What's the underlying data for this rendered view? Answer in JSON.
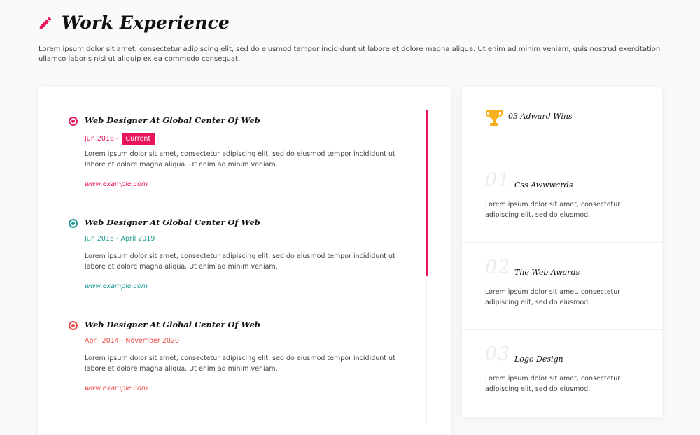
{
  "header": {
    "title": "Work Experience",
    "icon": "pencil-icon",
    "intro": "Lorem ipsum dolor sit amet, consectetur adipiscing elit, sed do eiusmod tempor incididunt ut labore et dolore magna aliqua. Ut enim ad minim veniam, quis nostrud exercitation ullamco laboris nisi ut aliquip ex ea commodo consequat."
  },
  "colors": {
    "accent": "#e9155b",
    "teal": "#1b9a8f",
    "coral": "#ec4c4c",
    "gold": "#f5b11b"
  },
  "experience": [
    {
      "title": "Web Designer At Global Center Of Web",
      "date": "Jun 2018 -",
      "badge": "Current",
      "description": "Lorem ipsum dolor sit amet, consectetur adipiscing elit, sed do eiusmod tempor incididunt ut labore et dolore magna aliqua. Ut enim ad minim veniam.",
      "link": "www.example.com"
    },
    {
      "title": "Web Designer At Global Center Of Web",
      "date": "Jun 2015 - April 2019",
      "description": "Lorem ipsum dolor sit amet, consectetur adipiscing elit, sed do eiusmod tempor incididunt ut labore et dolore magna aliqua. Ut enim ad minim veniam.",
      "link": "www.example.com"
    },
    {
      "title": "Web Designer At Global Center Of Web",
      "date": "April 2014 - November 2020",
      "description": "Lorem ipsum dolor sit amet, consectetur adipiscing elit, sed do eiusmod tempor incididunt ut labore et dolore magna aliqua. Ut enim ad minim veniam.",
      "link": "www.example.com"
    }
  ],
  "awards": {
    "count_label": "03 Adward Wins",
    "icon": "trophy-icon",
    "items": [
      {
        "number": "01",
        "title": "Css Awwwards",
        "description": "Lorem ipsum dolor sit amet, consectetur adipiscing elit, sed do eiusmod."
      },
      {
        "number": "02",
        "title": "The Web Awards",
        "description": "Lorem ipsum dolor sit amet, consectetur adipiscing elit, sed do eiusmod."
      },
      {
        "number": "03",
        "title": "Logo Design",
        "description": "Lorem ipsum dolor sit amet, consectetur adipiscing elit, sed do eiusmod."
      }
    ]
  }
}
